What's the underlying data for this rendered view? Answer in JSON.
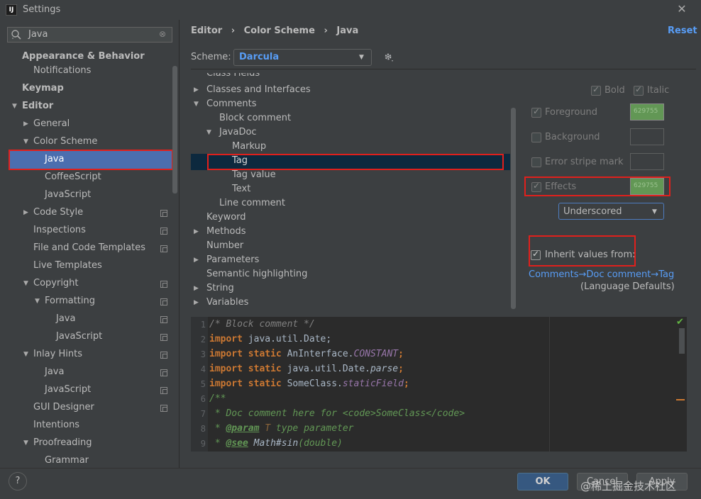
{
  "window": {
    "title": "Settings",
    "app_icon_text": "IJ"
  },
  "search": {
    "value": "Java"
  },
  "sidebar": {
    "items": [
      {
        "label": "Appearance & Behavior"
      },
      {
        "label": "Notifications"
      },
      {
        "label": "Keymap"
      },
      {
        "label": "Editor"
      },
      {
        "label": "General"
      },
      {
        "label": "Color Scheme"
      },
      {
        "label": "Java"
      },
      {
        "label": "CoffeeScript"
      },
      {
        "label": "JavaScript"
      },
      {
        "label": "Code Style"
      },
      {
        "label": "Inspections"
      },
      {
        "label": "File and Code Templates"
      },
      {
        "label": "Live Templates"
      },
      {
        "label": "Copyright"
      },
      {
        "label": "Formatting"
      },
      {
        "label": "Java"
      },
      {
        "label": "JavaScript"
      },
      {
        "label": "Inlay Hints"
      },
      {
        "label": "Java"
      },
      {
        "label": "JavaScript"
      },
      {
        "label": "GUI Designer"
      },
      {
        "label": "Intentions"
      },
      {
        "label": "Proofreading"
      },
      {
        "label": "Grammar"
      }
    ]
  },
  "header": {
    "crumb1": "Editor",
    "crumb2": "Color Scheme",
    "crumb3": "Java",
    "sep": "›",
    "reset": "Reset"
  },
  "scheme": {
    "label": "Scheme:",
    "value": "Darcula"
  },
  "tree": {
    "items": [
      {
        "label": "Class Fields"
      },
      {
        "label": "Classes and Interfaces"
      },
      {
        "label": "Comments"
      },
      {
        "label": "Block comment"
      },
      {
        "label": "JavaDoc"
      },
      {
        "label": "Markup"
      },
      {
        "label": "Tag"
      },
      {
        "label": "Tag value"
      },
      {
        "label": "Text"
      },
      {
        "label": "Line comment"
      },
      {
        "label": "Keyword"
      },
      {
        "label": "Methods"
      },
      {
        "label": "Number"
      },
      {
        "label": "Parameters"
      },
      {
        "label": "Semantic highlighting"
      },
      {
        "label": "String"
      },
      {
        "label": "Variables"
      }
    ]
  },
  "attributes": {
    "bold": "Bold",
    "italic": "Italic",
    "foreground": "Foreground",
    "foreground_hex": "629755",
    "background": "Background",
    "error_stripe": "Error stripe mark",
    "effects": "Effects",
    "effects_hex": "629755",
    "effects_type": "Underscored",
    "inherit_label": "Inherit values from:",
    "inherit_link": "Comments→Doc comment→Tag",
    "inherit_sub": "(Language Defaults)",
    "swatch_color": "#629755"
  },
  "preview": {
    "line_numbers": [
      "1",
      "2",
      "3",
      "4",
      "5",
      "6",
      "7",
      "8",
      "9"
    ],
    "l1": "/* Block comment */",
    "l2_kw": "import",
    "l2_rest": " java.util.Date;",
    "l3_kw": "import static",
    "l3_rest": " AnInterface.",
    "l3_const": "CONSTANT",
    "l3_end": ";",
    "l4_kw": "import static",
    "l4_rest": " java.util.Date.",
    "l4_const": "parse",
    "l4_end": ";",
    "l5_kw": "import static",
    "l5_rest": " SomeClass.",
    "l5_const": "staticField",
    "l5_end": ";",
    "l6": "/**",
    "l7": " * Doc comment here for <code>SomeClass</code>",
    "l8_pre": " * ",
    "l8_tag": "@param",
    "l8_mid": " T",
    "l8_rest": " type parameter",
    "l9_pre": " * ",
    "l9_tag": "@see",
    "l9_rest": " Math#sin",
    "l9_end": "(double)"
  },
  "buttons": {
    "help": "?",
    "ok": "OK",
    "cancel": "Cancel",
    "apply": "Apply"
  },
  "watermark": "@稀土掘金技术社区"
}
